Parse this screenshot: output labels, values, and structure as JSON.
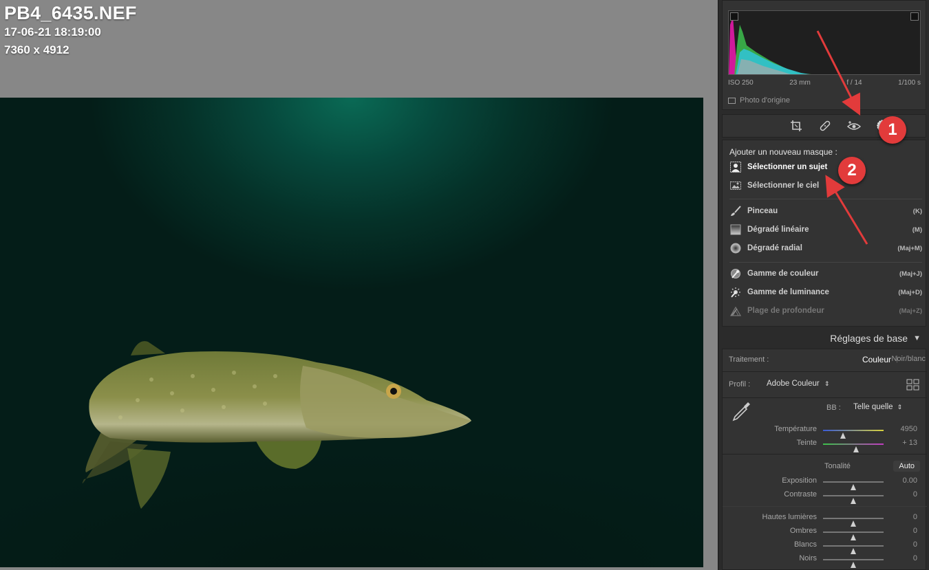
{
  "meta": {
    "filename": "PB4_6435.NEF",
    "datetime": "17-06-21 18:19:00",
    "dimensions": "7360 x 4912"
  },
  "histogram": {
    "exif": [
      "ISO 250",
      "23 mm",
      "f / 14",
      "1/100 s"
    ],
    "original_photo_label": "Photo d'origine"
  },
  "tools": [
    "crop-icon",
    "healing-icon",
    "redeye-icon",
    "masking-icon"
  ],
  "masking": {
    "title": "Ajouter un nouveau masque :",
    "items": [
      {
        "label": "Sélectionner un sujet",
        "key": "",
        "icon": "select-subject-icon"
      },
      {
        "label": "Sélectionner le ciel",
        "key": "",
        "icon": "select-sky-icon"
      },
      {
        "label": "Pinceau",
        "key": "(K)",
        "icon": "brush-icon"
      },
      {
        "label": "Dégradé linéaire",
        "key": "(M)",
        "icon": "linear-gradient-icon"
      },
      {
        "label": "Dégradé radial",
        "key": "(Maj+M)",
        "icon": "radial-gradient-icon"
      },
      {
        "label": "Gamme de couleur",
        "key": "(Maj+J)",
        "icon": "color-range-icon"
      },
      {
        "label": "Gamme de luminance",
        "key": "(Maj+D)",
        "icon": "luminance-range-icon"
      },
      {
        "label": "Plage de profondeur",
        "key": "(Maj+Z)",
        "icon": "depth-range-icon"
      }
    ]
  },
  "basic": {
    "header": "Réglages de base",
    "treatment_label": "Traitement :",
    "treatment_color": "Couleur",
    "treatment_bw": "Noir/blanc",
    "profile_label": "Profil :",
    "profile_value": "Adobe Couleur",
    "wb_label": "BB :",
    "wb_value": "Telle quelle",
    "tone_label": "Tonalité",
    "auto_label": "Auto",
    "sliders": [
      {
        "label": "Température",
        "value": "4950",
        "pos": 0.33
      },
      {
        "label": "Teinte",
        "value": "+ 13",
        "pos": 0.55
      },
      {
        "label": "Exposition",
        "value": "0.00",
        "pos": 0.5
      },
      {
        "label": "Contraste",
        "value": "0",
        "pos": 0.5
      },
      {
        "label": "Hautes lumières",
        "value": "0",
        "pos": 0.5
      },
      {
        "label": "Ombres",
        "value": "0",
        "pos": 0.5
      },
      {
        "label": "Blancs",
        "value": "0",
        "pos": 0.5
      },
      {
        "label": "Noirs",
        "value": "0",
        "pos": 0.5
      }
    ]
  },
  "annotations": {
    "badge1": "1",
    "badge2": "2",
    "accent": "#e23b3b"
  }
}
